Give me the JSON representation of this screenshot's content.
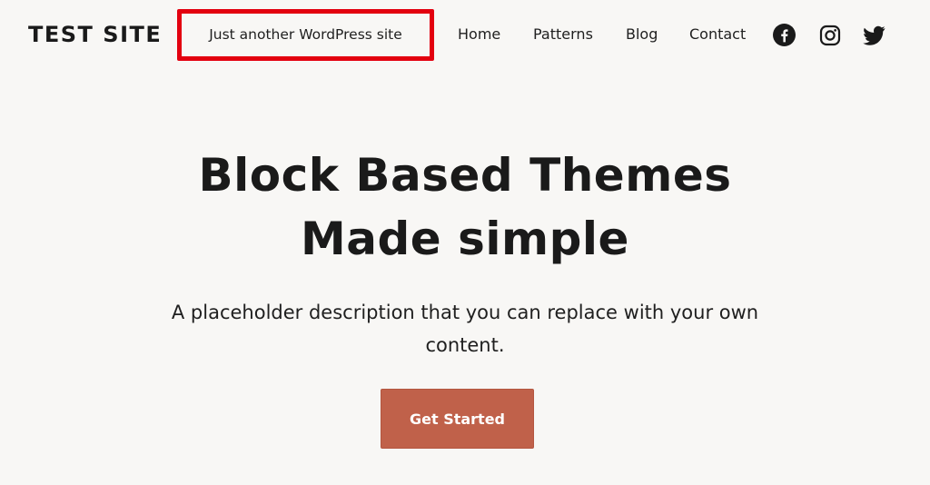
{
  "header": {
    "site_title": "TEST SITE",
    "tagline": "Just another WordPress site",
    "nav": [
      {
        "label": "Home"
      },
      {
        "label": "Patterns"
      },
      {
        "label": "Blog"
      },
      {
        "label": "Contact"
      }
    ],
    "social": [
      {
        "icon": "facebook-icon"
      },
      {
        "icon": "instagram-icon"
      },
      {
        "icon": "twitter-icon"
      }
    ]
  },
  "hero": {
    "title": "Block Based Themes Made simple",
    "description": "A placeholder description that you can replace with your own content.",
    "cta_label": "Get Started"
  },
  "colors": {
    "background": "#f8f7f5",
    "highlight_border": "#e3000f",
    "button": "#c0614a",
    "text": "#1f1f1f"
  }
}
